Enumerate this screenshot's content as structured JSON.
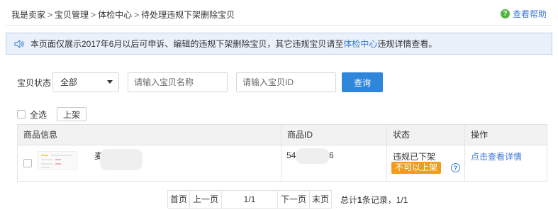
{
  "breadcrumb": {
    "items": [
      "我是卖家",
      "宝贝管理",
      "体检中心",
      "待处理违规下架删除宝贝"
    ],
    "separator": ">"
  },
  "help": {
    "label": "查看帮助",
    "icon": "question-circle-icon"
  },
  "notice": {
    "icon": "speaker-icon",
    "text_before": "本页面仅展示2017年6月以后可申诉、编辑的违规下架删除宝贝，其它违规宝贝请至",
    "link": "体检中心",
    "text_after": "违规详情查看。"
  },
  "filters": {
    "status_label": "宝贝状态",
    "status_value": "全部",
    "name_placeholder": "请输入宝贝名称",
    "id_placeholder": "请输入宝贝ID",
    "query_button": "查询"
  },
  "bulk": {
    "select_all": "全选",
    "relist_button": "上架"
  },
  "table": {
    "headers": [
      "商品信息",
      "商品ID",
      "状态",
      "操作"
    ],
    "rows": [
      {
        "name": "麦",
        "id_prefix": "54",
        "id_suffix": "06",
        "status": "违规已下架",
        "badge": "不可以上架",
        "action": "点击查看详情"
      }
    ]
  },
  "pagination": {
    "first": "首页",
    "prev": "上一页",
    "page": "1/1",
    "next": "下一页",
    "last": "末页",
    "info_prefix": "总计",
    "count": "1",
    "info_suffix": "条记录，1/1"
  },
  "colors": {
    "link": "#3d7ad6",
    "primary": "#2f87dc",
    "badge": "#f39b1b",
    "notice_bg": "#eaf1fb",
    "help_icon": "#52b43e"
  }
}
